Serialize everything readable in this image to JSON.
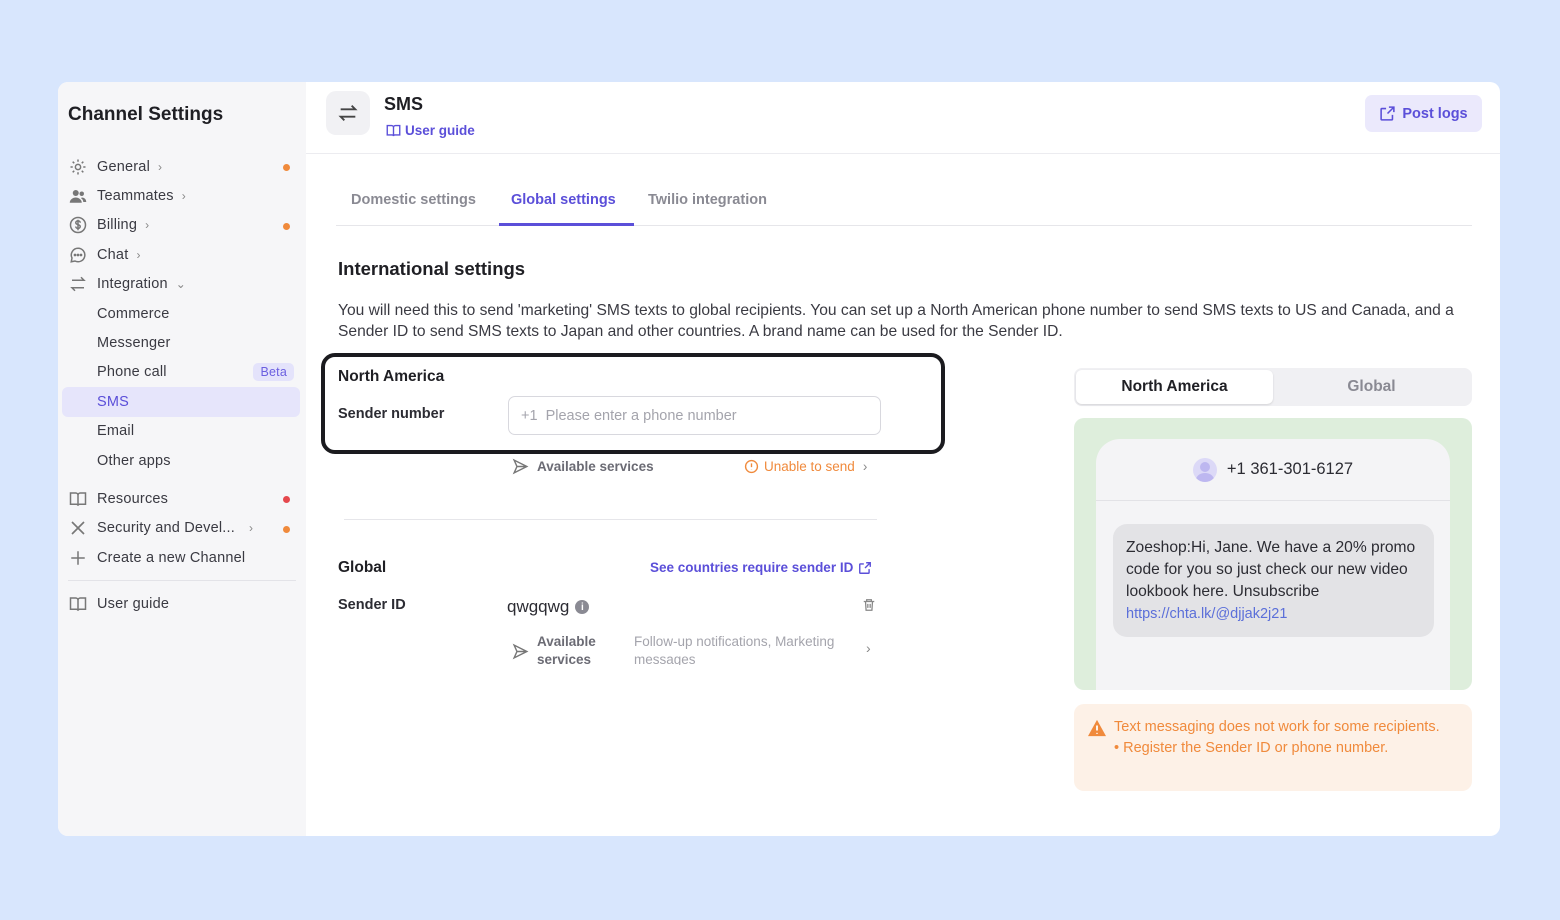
{
  "sidebar": {
    "title": "Channel Settings",
    "items": [
      {
        "label": "General",
        "icon": "gear-icon"
      },
      {
        "label": "Teammates",
        "icon": "users-icon"
      },
      {
        "label": "Billing",
        "icon": "dollar-icon"
      },
      {
        "label": "Chat",
        "icon": "chat-icon"
      },
      {
        "label": "Integration",
        "icon": "arrows-icon"
      },
      {
        "label": "Commerce"
      },
      {
        "label": "Messenger"
      },
      {
        "label": "Phone call",
        "badge": "Beta"
      },
      {
        "label": "SMS",
        "active": true
      },
      {
        "label": "Email"
      },
      {
        "label": "Other apps"
      },
      {
        "label": "Resources",
        "icon": "book-icon"
      },
      {
        "label": "Security and Devel...",
        "icon": "tools-icon"
      },
      {
        "label": "Create a new Channel",
        "icon": "plus-icon"
      },
      {
        "label": "User guide",
        "icon": "book-icon"
      }
    ]
  },
  "header": {
    "title": "SMS",
    "user_guide": "User guide",
    "post_logs": "Post logs"
  },
  "tabs": [
    "Domestic settings",
    "Global settings",
    "Twilio integration"
  ],
  "active_tab": "Global settings",
  "content": {
    "section_title": "International settings",
    "description": "You will need this to send 'marketing' SMS texts to global recipients. You can set up a North American phone number to send SMS texts to US and Canada, and a Sender ID to send SMS texts to Japan and other countries. A brand name can be used for the Sender ID.",
    "north_america": {
      "label": "North America",
      "sender_number_label": "Sender number",
      "phone_placeholder": "+1  Please enter a phone number",
      "available_services": "Available services",
      "unable_to_send": "Unable to send"
    },
    "global": {
      "label": "Global",
      "see_countries": "See countries require sender ID",
      "sender_id_label": "Sender ID",
      "sender_id_value": "qwgqwg",
      "available_services_1": "Available",
      "available_services_2": "services",
      "services_list": "Follow-up notifications, Marketing messages"
    }
  },
  "preview": {
    "segment_active": "North America",
    "segment_inactive": "Global",
    "phone_number": "+1 361-301-6127",
    "message": "Zoeshop:Hi, Jane. We have a 20% promo code for you so just check our new video lookbook here. Unsubscribe",
    "message_link": "https://chta.lk/@djjak2j21"
  },
  "warning": {
    "line1": "Text messaging does not work for some recipients.",
    "line2": "• Register the Sender ID or phone number."
  },
  "colors": {
    "accent": "#5b4fd9",
    "warning": "#f08a3c",
    "background": "#d8e6fd"
  }
}
